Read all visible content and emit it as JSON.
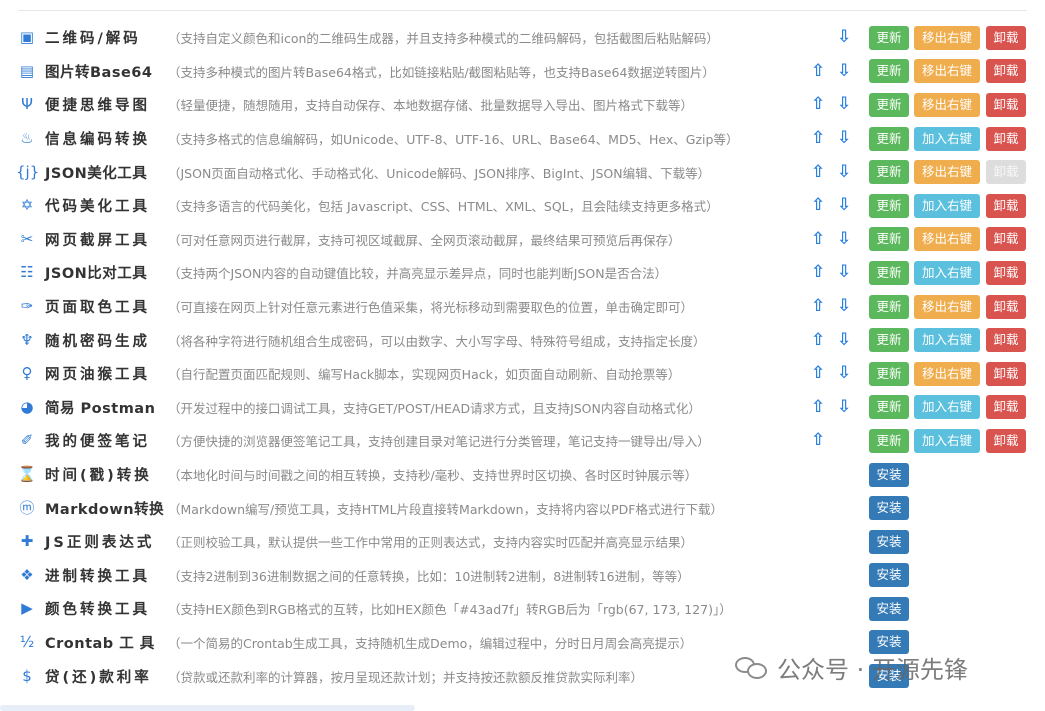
{
  "header_cut": {
    "part1": "· · · · · · · · · · · · · · · · · · · · · · · · ·",
    "part2": "· · · · · · ·",
    "part3": "· · · · · · · · · · · ·",
    "part4": "· · · · · · · · ·"
  },
  "buttons": {
    "update": "更新",
    "move_right": "移出右键",
    "add_right": "加入右键",
    "unload": "卸载",
    "install": "安装"
  },
  "arrows": {
    "up": "⇧",
    "down": "⇩"
  },
  "tools": [
    {
      "id": "qrcode",
      "icon": "▣",
      "name": "二维码/解码",
      "desc": "（支持自定义颜色和icon的二维码生成器，并且支持多种模式的二维码解码，包括截图后粘贴解码）",
      "installed": true,
      "up": false,
      "down": true,
      "menu": "move",
      "unload_disabled": false
    },
    {
      "id": "img-base64",
      "icon": "▤",
      "name": "图片转Base64",
      "desc": "（支持多种模式的图片转Base64格式，比如链接粘贴/截图粘贴等，也支持Base64数据逆转图片）",
      "installed": true,
      "up": true,
      "down": true,
      "menu": "move",
      "unload_disabled": false
    },
    {
      "id": "mindmap",
      "icon": "Ψ",
      "name": "便捷思维导图",
      "desc": "（轻量便捷，随想随用，支持自动保存、本地数据存储、批量数据导入导出、图片格式下载等）",
      "installed": true,
      "up": true,
      "down": true,
      "menu": "move",
      "unload_disabled": false
    },
    {
      "id": "encode",
      "icon": "♨",
      "name": "信息编码转换",
      "desc": "（支持多格式的信息编解码，如Unicode、UTF-8、UTF-16、URL、Base64、MD5、Hex、Gzip等）",
      "installed": true,
      "up": true,
      "down": true,
      "menu": "add",
      "unload_disabled": false
    },
    {
      "id": "json",
      "icon": "{j}",
      "name": "JSON美化工具",
      "desc": "（JSON页面自动格式化、手动格式化、Unicode解码、JSON排序、BigInt、JSON编辑、下载等）",
      "installed": true,
      "up": true,
      "down": true,
      "menu": "move",
      "unload_disabled": true
    },
    {
      "id": "code",
      "icon": "✡",
      "name": "代码美化工具",
      "desc": "（支持多语言的代码美化，包括 Javascript、CSS、HTML、XML、SQL，且会陆续支持更多格式）",
      "installed": true,
      "up": true,
      "down": true,
      "menu": "add",
      "unload_disabled": false
    },
    {
      "id": "screenshot",
      "icon": "✂",
      "name": "网页截屏工具",
      "desc": "（可对任意网页进行截屏，支持可视区域截屏、全网页滚动截屏，最终结果可预览后再保存）",
      "installed": true,
      "up": true,
      "down": true,
      "menu": "move",
      "unload_disabled": false
    },
    {
      "id": "json-diff",
      "icon": "☷",
      "name": "JSON比对工具",
      "desc": "（支持两个JSON内容的自动键值比较，并高亮显示差异点，同时也能判断JSON是否合法）",
      "installed": true,
      "up": true,
      "down": true,
      "menu": "add",
      "unload_disabled": false
    },
    {
      "id": "color-picker",
      "icon": "✑",
      "name": "页面取色工具",
      "desc": "（可直接在网页上针对任意元素进行色值采集，将光标移动到需要取色的位置，单击确定即可）",
      "installed": true,
      "up": true,
      "down": true,
      "menu": "move",
      "unload_disabled": false
    },
    {
      "id": "password",
      "icon": "♆",
      "name": "随机密码生成",
      "desc": "（将各种字符进行随机组合生成密码，可以由数字、大小写字母、特殊符号组成，支持指定长度）",
      "installed": true,
      "up": true,
      "down": true,
      "menu": "add",
      "unload_disabled": false
    },
    {
      "id": "monkey",
      "icon": "♀",
      "name": "网页油猴工具",
      "desc": "（自行配置页面匹配规则、编写Hack脚本，实现网页Hack，如页面自动刷新、自动抢票等）",
      "installed": true,
      "up": true,
      "down": true,
      "menu": "move",
      "unload_disabled": false
    },
    {
      "id": "postman",
      "icon": "◕",
      "name": "简易 Postman",
      "desc": "（开发过程中的接口调试工具，支持GET/POST/HEAD请求方式，且支持JSON内容自动格式化）",
      "installed": true,
      "up": true,
      "down": true,
      "menu": "add",
      "unload_disabled": false
    },
    {
      "id": "sticky",
      "icon": "✐",
      "name": "我的便签笔记",
      "desc": "（方便快捷的浏览器便签笔记工具，支持创建目录对笔记进行分类管理，笔记支持一键导出/导入）",
      "installed": true,
      "up": true,
      "down": false,
      "menu": "add",
      "unload_disabled": false
    },
    {
      "id": "timestamp",
      "icon": "⌛",
      "name": "时间(戳)转换",
      "desc": "（本地化时间与时间戳之间的相互转换，支持秒/毫秒、支持世界时区切换、各时区时钟展示等）",
      "installed": false
    },
    {
      "id": "markdown",
      "icon": "ⓜ",
      "name": "Markdown转换",
      "desc": "（Markdown编写/预览工具，支持HTML片段直接转Markdown，支持将内容以PDF格式进行下载）",
      "installed": false
    },
    {
      "id": "regex",
      "icon": "✚",
      "name": "JS正则表达式",
      "desc": "（正则校验工具，默认提供一些工作中常用的正则表达式，支持内容实时匹配并高亮显示结果）",
      "installed": false
    },
    {
      "id": "radix",
      "icon": "❖",
      "name": "进制转换工具",
      "desc": "（支持2进制到36进制数据之间的任意转换，比如：10进制转2进制，8进制转16进制，等等）",
      "installed": false
    },
    {
      "id": "color-convert",
      "icon": "▶",
      "name": "颜色转换工具",
      "desc": "（支持HEX颜色到RGB格式的互转，比如HEX颜色「#43ad7f」转RGB后为「rgb(67, 173, 127)」）",
      "installed": false
    },
    {
      "id": "crontab",
      "icon": "½",
      "name": "Crontab 工 具",
      "desc": "（一个简易的Crontab生成工具，支持随机生成Demo，编辑过程中，分时日月周会高亮提示）",
      "installed": false
    },
    {
      "id": "loan",
      "icon": "$",
      "name": "贷(还)款利率",
      "desc": "（贷款或还款利率的计算器，按月呈现还款计划；并支持按还款额反推贷款实际利率）",
      "installed": false
    }
  ],
  "watermark": {
    "text": "公众号 · 开源先锋",
    "icon": "wechat-icon"
  }
}
